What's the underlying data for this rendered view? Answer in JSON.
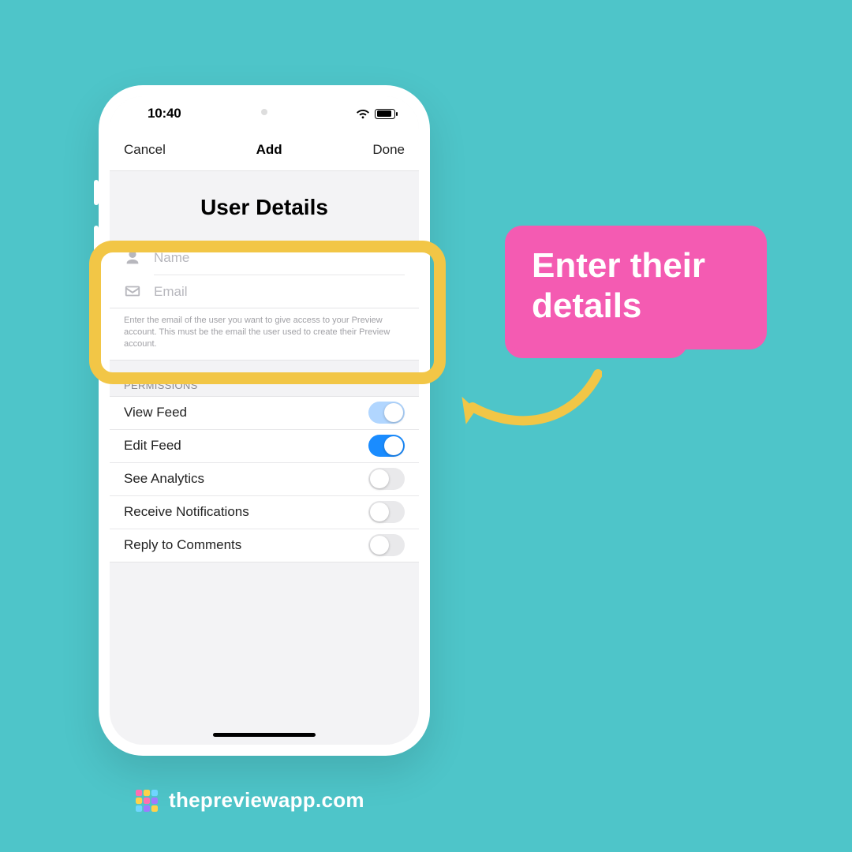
{
  "statusbar": {
    "time": "10:40"
  },
  "nav": {
    "cancel": "Cancel",
    "title": "Add",
    "done": "Done"
  },
  "section": {
    "title": "User Details"
  },
  "form": {
    "name_placeholder": "Name",
    "email_placeholder": "Email",
    "helper": "Enter the email of the user you want to give access to your Preview account. This must be the email the user used to create their Preview account."
  },
  "permissions": {
    "header": "PERMISSIONS",
    "items": [
      {
        "label": "View Feed",
        "state": "on-lightblue"
      },
      {
        "label": "Edit Feed",
        "state": "on-blue"
      },
      {
        "label": "See Analytics",
        "state": "off"
      },
      {
        "label": "Receive Notifications",
        "state": "off"
      },
      {
        "label": "Reply to Comments",
        "state": "off"
      }
    ]
  },
  "callout": {
    "line1": "Enter their",
    "line2": "details"
  },
  "footer": {
    "site": "thepreviewapp.com"
  }
}
